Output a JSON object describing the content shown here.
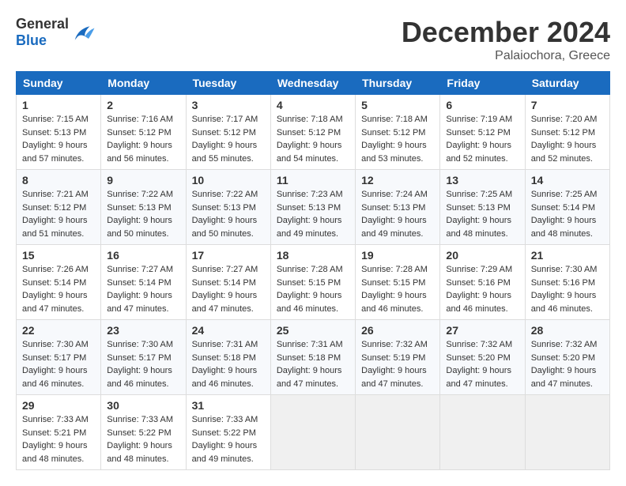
{
  "header": {
    "logo_general": "General",
    "logo_blue": "Blue",
    "month_title": "December 2024",
    "location": "Palaiochora, Greece"
  },
  "days_of_week": [
    "Sunday",
    "Monday",
    "Tuesday",
    "Wednesday",
    "Thursday",
    "Friday",
    "Saturday"
  ],
  "weeks": [
    [
      {
        "day": "1",
        "sunrise": "7:15 AM",
        "sunset": "5:13 PM",
        "daylight": "9 hours and 57 minutes."
      },
      {
        "day": "2",
        "sunrise": "7:16 AM",
        "sunset": "5:12 PM",
        "daylight": "9 hours and 56 minutes."
      },
      {
        "day": "3",
        "sunrise": "7:17 AM",
        "sunset": "5:12 PM",
        "daylight": "9 hours and 55 minutes."
      },
      {
        "day": "4",
        "sunrise": "7:18 AM",
        "sunset": "5:12 PM",
        "daylight": "9 hours and 54 minutes."
      },
      {
        "day": "5",
        "sunrise": "7:18 AM",
        "sunset": "5:12 PM",
        "daylight": "9 hours and 53 minutes."
      },
      {
        "day": "6",
        "sunrise": "7:19 AM",
        "sunset": "5:12 PM",
        "daylight": "9 hours and 52 minutes."
      },
      {
        "day": "7",
        "sunrise": "7:20 AM",
        "sunset": "5:12 PM",
        "daylight": "9 hours and 52 minutes."
      }
    ],
    [
      {
        "day": "8",
        "sunrise": "7:21 AM",
        "sunset": "5:12 PM",
        "daylight": "9 hours and 51 minutes."
      },
      {
        "day": "9",
        "sunrise": "7:22 AM",
        "sunset": "5:13 PM",
        "daylight": "9 hours and 50 minutes."
      },
      {
        "day": "10",
        "sunrise": "7:22 AM",
        "sunset": "5:13 PM",
        "daylight": "9 hours and 50 minutes."
      },
      {
        "day": "11",
        "sunrise": "7:23 AM",
        "sunset": "5:13 PM",
        "daylight": "9 hours and 49 minutes."
      },
      {
        "day": "12",
        "sunrise": "7:24 AM",
        "sunset": "5:13 PM",
        "daylight": "9 hours and 49 minutes."
      },
      {
        "day": "13",
        "sunrise": "7:25 AM",
        "sunset": "5:13 PM",
        "daylight": "9 hours and 48 minutes."
      },
      {
        "day": "14",
        "sunrise": "7:25 AM",
        "sunset": "5:14 PM",
        "daylight": "9 hours and 48 minutes."
      }
    ],
    [
      {
        "day": "15",
        "sunrise": "7:26 AM",
        "sunset": "5:14 PM",
        "daylight": "9 hours and 47 minutes."
      },
      {
        "day": "16",
        "sunrise": "7:27 AM",
        "sunset": "5:14 PM",
        "daylight": "9 hours and 47 minutes."
      },
      {
        "day": "17",
        "sunrise": "7:27 AM",
        "sunset": "5:14 PM",
        "daylight": "9 hours and 47 minutes."
      },
      {
        "day": "18",
        "sunrise": "7:28 AM",
        "sunset": "5:15 PM",
        "daylight": "9 hours and 46 minutes."
      },
      {
        "day": "19",
        "sunrise": "7:28 AM",
        "sunset": "5:15 PM",
        "daylight": "9 hours and 46 minutes."
      },
      {
        "day": "20",
        "sunrise": "7:29 AM",
        "sunset": "5:16 PM",
        "daylight": "9 hours and 46 minutes."
      },
      {
        "day": "21",
        "sunrise": "7:30 AM",
        "sunset": "5:16 PM",
        "daylight": "9 hours and 46 minutes."
      }
    ],
    [
      {
        "day": "22",
        "sunrise": "7:30 AM",
        "sunset": "5:17 PM",
        "daylight": "9 hours and 46 minutes."
      },
      {
        "day": "23",
        "sunrise": "7:30 AM",
        "sunset": "5:17 PM",
        "daylight": "9 hours and 46 minutes."
      },
      {
        "day": "24",
        "sunrise": "7:31 AM",
        "sunset": "5:18 PM",
        "daylight": "9 hours and 46 minutes."
      },
      {
        "day": "25",
        "sunrise": "7:31 AM",
        "sunset": "5:18 PM",
        "daylight": "9 hours and 47 minutes."
      },
      {
        "day": "26",
        "sunrise": "7:32 AM",
        "sunset": "5:19 PM",
        "daylight": "9 hours and 47 minutes."
      },
      {
        "day": "27",
        "sunrise": "7:32 AM",
        "sunset": "5:20 PM",
        "daylight": "9 hours and 47 minutes."
      },
      {
        "day": "28",
        "sunrise": "7:32 AM",
        "sunset": "5:20 PM",
        "daylight": "9 hours and 47 minutes."
      }
    ],
    [
      {
        "day": "29",
        "sunrise": "7:33 AM",
        "sunset": "5:21 PM",
        "daylight": "9 hours and 48 minutes."
      },
      {
        "day": "30",
        "sunrise": "7:33 AM",
        "sunset": "5:22 PM",
        "daylight": "9 hours and 48 minutes."
      },
      {
        "day": "31",
        "sunrise": "7:33 AM",
        "sunset": "5:22 PM",
        "daylight": "9 hours and 49 minutes."
      },
      null,
      null,
      null,
      null
    ]
  ]
}
